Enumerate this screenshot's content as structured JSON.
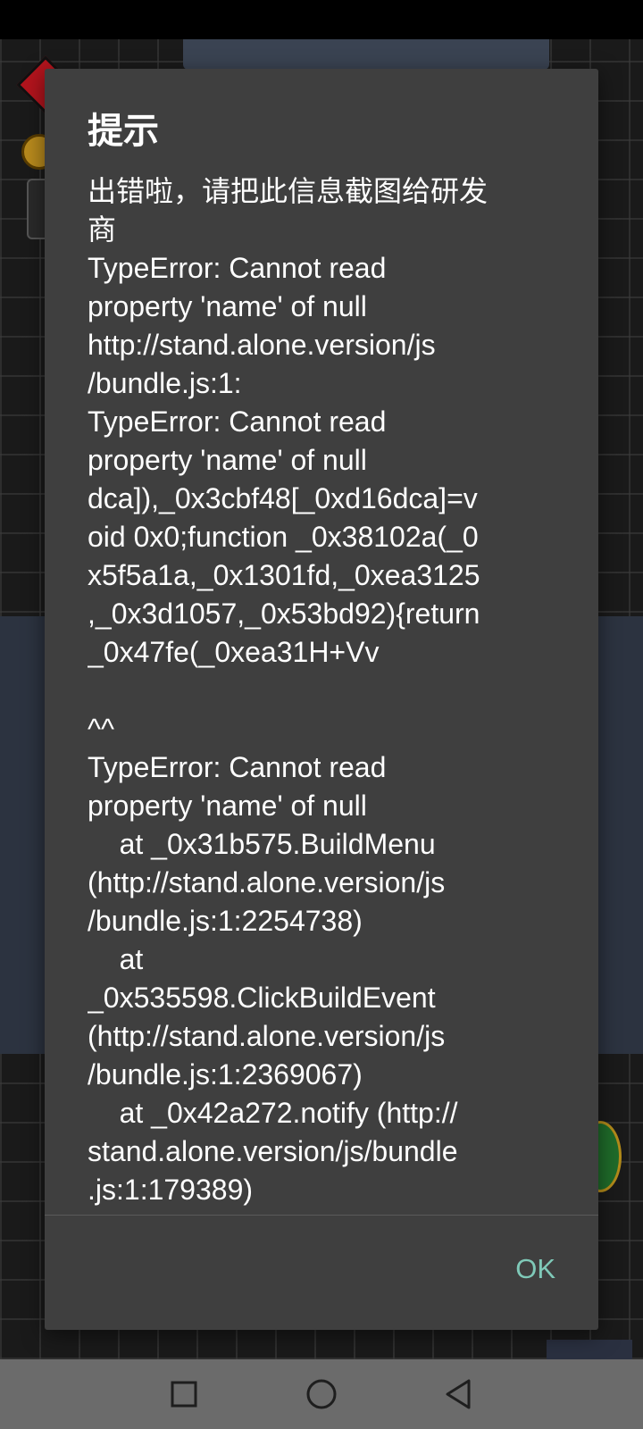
{
  "dialog": {
    "title": "提示",
    "message": "出错啦，请把此信息截图给研发\n商\nTypeError: Cannot read\nproperty 'name' of null\nhttp://stand.alone.version/js\n/bundle.js:1:\nTypeError: Cannot read\nproperty 'name' of null\ndca]),_0x3cbf48[_0xd16dca]=v\noid 0x0;function _0x38102a(_0\nx5f5a1a,_0x1301fd,_0xea3125\n,_0x3d1057,_0x53bd92){return\n_0x47fe(_0xea31H+Vv\n\n^^\nTypeError: Cannot read\nproperty 'name' of null\n    at _0x31b575.BuildMenu\n(http://stand.alone.version/js\n/bundle.js:1:2254738)\n    at\n_0x535598.ClickBuildEvent\n(http://stand.alone.version/js\n/bundle.js:1:2369067)\n    at _0x42a272.notify (http://\nstand.alone.version/js/bundle\n.js:1:179389)",
    "ok_label": "OK"
  },
  "navigation_bar": {
    "recent_icon": "square-recent-apps-icon",
    "home_icon": "circle-home-icon",
    "back_icon": "triangle-back-icon"
  },
  "colors": {
    "dialog_background": "#3f3f3f",
    "accent_ok": "#7fc9b8",
    "nav_bar": "#6b6b6b"
  }
}
